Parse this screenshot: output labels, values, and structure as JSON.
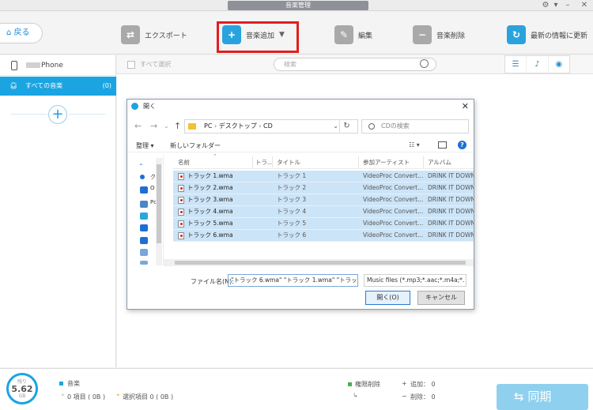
{
  "app": {
    "title": "音楽管理"
  },
  "toolbar": {
    "back_label": "戻る",
    "export_label": "エクスポート",
    "add_music_label": "音楽追加",
    "edit_label": "編集",
    "delete_label": "音楽削除",
    "refresh_label": "最新の情報に更新",
    "highlight_color": "#e21e1e"
  },
  "sidebar": {
    "device_name": "Phone",
    "all_music_label": "すべての音楽",
    "all_music_count": "(0)"
  },
  "list": {
    "select_all_label": "すべて選択",
    "search_placeholder": "検索"
  },
  "dialog": {
    "title": "開く",
    "path": [
      "PC",
      "デスクトップ",
      "CD"
    ],
    "search_placeholder": "CDの検索",
    "organize_label": "整理",
    "new_folder_label": "新しいフォルダー",
    "nav_items": [
      "ク",
      "O",
      "Pc"
    ],
    "columns": [
      "名前",
      "トラ...",
      "タイトル",
      "参加アーティスト",
      "アルバム"
    ],
    "files": [
      {
        "name": "トラック 1.wma",
        "title": "トラック 1",
        "artist": "VideoProc Convert...",
        "album": "DRINK IT DOWN"
      },
      {
        "name": "トラック 2.wma",
        "title": "トラック 2",
        "artist": "VideoProc Convert...",
        "album": "DRINK IT DOWN"
      },
      {
        "name": "トラック 3.wma",
        "title": "トラック 3",
        "artist": "VideoProc Convert...",
        "album": "DRINK IT DOWN"
      },
      {
        "name": "トラック 4.wma",
        "title": "トラック 4",
        "artist": "VideoProc Convert...",
        "album": "DRINK IT DOWN"
      },
      {
        "name": "トラック 5.wma",
        "title": "トラック 5",
        "artist": "VideoProc Convert...",
        "album": "DRINK IT DOWN"
      },
      {
        "name": "トラック 6.wma",
        "title": "トラック 6",
        "artist": "VideoProc Convert...",
        "album": "DRINK IT DOWN"
      }
    ],
    "filename_label": "ファイル名(N):",
    "filename_value": "\"トラック 6.wma\" \"トラック 1.wma\" \"トラック 2.w",
    "filetype_value": "Music files (*.mp3;*.aac;*.m4a;*.",
    "open_label": "開く(O)",
    "cancel_label": "キャンセル"
  },
  "status": {
    "storage_label": "残り",
    "storage_value": "5.62",
    "storage_unit": "GB",
    "music_label": "音楽",
    "items_text": "0 項目 ( 0B )",
    "selected_text": "選択項目 0 ( 0B )",
    "delete_label": "権限削除",
    "added_text": "追加： 0",
    "removed_text": "削除： 0",
    "sync_label": "同期",
    "accent_color": "#1aa4e2"
  }
}
